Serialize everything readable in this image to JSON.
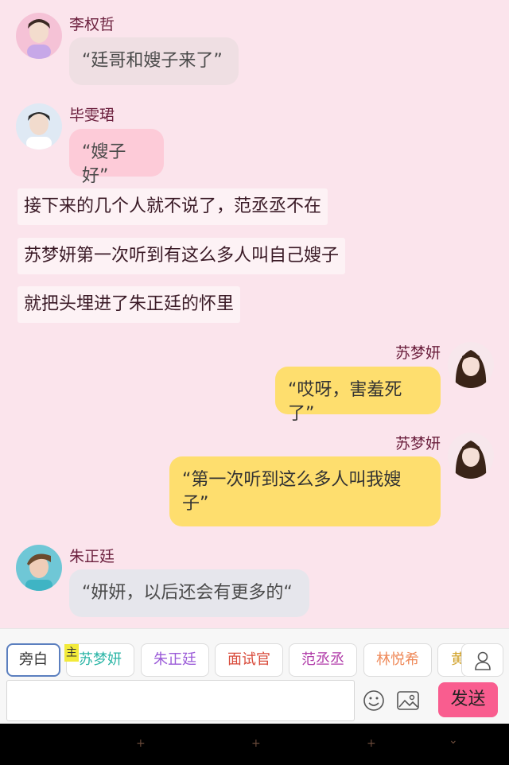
{
  "messages": [
    {
      "type": "left",
      "name": "李权哲",
      "text": "“廷哥和嫂子来了”"
    },
    {
      "type": "left",
      "name": "毕雯珺",
      "text": "“嫂子好”"
    },
    {
      "type": "narration",
      "text": "接下来的几个人就不说了，范丞丞不在"
    },
    {
      "type": "narration",
      "text": "苏梦妍第一次听到有这么多人叫自己嫂子"
    },
    {
      "type": "narration",
      "text": "就把头埋进了朱正廷的怀里"
    },
    {
      "type": "right",
      "name": "苏梦妍",
      "text": "“哎呀，害羞死了”"
    },
    {
      "type": "right",
      "name": "苏梦妍",
      "text_line1": "“第一次听到这么多人叫我嫂",
      "text_line2": "子”"
    },
    {
      "type": "left",
      "name": "朱正廷",
      "text": "“妍妍，以后还会有更多的“"
    }
  ],
  "toolbar": {
    "characters": [
      {
        "label": "旁白",
        "color": "#333333"
      },
      {
        "label": "苏梦妍",
        "color": "#2bb5a6"
      },
      {
        "label": "朱正廷",
        "color": "#9b5bd8"
      },
      {
        "label": "面试官",
        "color": "#d84a3a"
      },
      {
        "label": "范丞丞",
        "color": "#b03aa8"
      },
      {
        "label": "林悦希",
        "color": "#ef8a5a"
      },
      {
        "label": "黄",
        "color": "#d1a22a"
      }
    ],
    "main_badge": "主",
    "input_placeholder": "",
    "send_label": "发送"
  },
  "navbar": {
    "plus": "+",
    "chevron": "⌄"
  }
}
